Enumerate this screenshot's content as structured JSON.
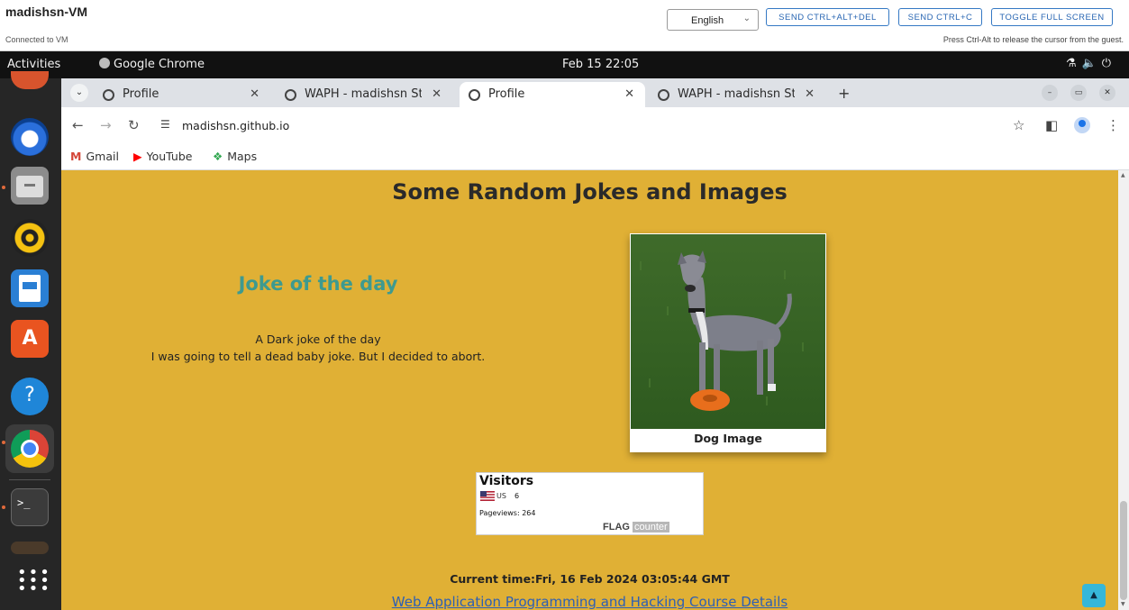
{
  "vm": {
    "title": "madishsn-VM",
    "status": "Connected to VM",
    "language": "English",
    "buttons": [
      "SEND CTRL+ALT+DEL",
      "SEND CTRL+C",
      "TOGGLE FULL SCREEN"
    ],
    "hint": "Press Ctrl-Alt to release the cursor from the guest."
  },
  "topbar": {
    "activities": "Activities",
    "app": "Google Chrome",
    "clock": "Feb 15  22:05"
  },
  "dock": {
    "items": [
      "firefox",
      "thunderbird",
      "files",
      "rhythmbox",
      "writer",
      "software",
      "help",
      "chrome",
      "terminal",
      "show-apps"
    ]
  },
  "browser": {
    "tabs": [
      {
        "title": "Profile",
        "active": false
      },
      {
        "title": "WAPH - madishsn Studer",
        "active": false
      },
      {
        "title": "Profile",
        "active": true
      },
      {
        "title": "WAPH - madishsn Studer",
        "active": false
      }
    ],
    "url": "madishsn.github.io",
    "bookmarks": [
      "Gmail",
      "YouTube",
      "Maps"
    ]
  },
  "page": {
    "heading": "Some Random Jokes and Images",
    "joke_title": "Joke of the day",
    "joke_line1": "A Dark joke of the day",
    "joke_line2": "I was going to tell a dead baby joke. But I decided to abort.",
    "dog_caption": "Dog Image",
    "visitors": {
      "title": "Visitors",
      "country": "US",
      "count": "6",
      "pageviews": "Pageviews: 264",
      "logo_a": "FLAG",
      "logo_b": "counter"
    },
    "current_time": "Current time:Fri, 16 Feb 2024 03:05:44 GMT",
    "course_link": "Web Application Programming and Hacking Course Details"
  },
  "colors": {
    "page_background": "#e0b035",
    "joke_title": "#3e9a8f",
    "link": "#2d5fb5",
    "back_to_top": "#36b7d9"
  }
}
